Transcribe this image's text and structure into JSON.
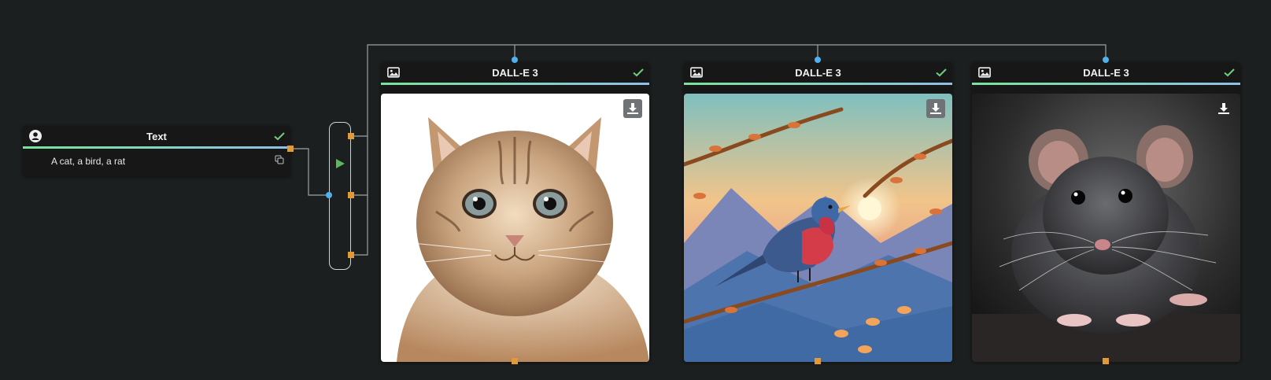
{
  "text_node": {
    "title": "Text",
    "content": "A cat, a bird, a rat"
  },
  "image_nodes": [
    {
      "title": "DALL-E 3",
      "image": "cat portrait",
      "icon": "image-icon"
    },
    {
      "title": "DALL-E 3",
      "image": "robin on branch at sunset",
      "icon": "image-icon"
    },
    {
      "title": "DALL-E 3",
      "image": "grey rat",
      "icon": "image-icon"
    }
  ],
  "colors": {
    "background": "#1c1f1f",
    "node": "#181718",
    "accent_green": "#79e39a",
    "accent_blue": "#8ebfe6",
    "port_orange": "#e19a35",
    "port_blue": "#4fb1ee",
    "check_green": "#6fcf7a"
  },
  "icons": [
    "user-icon",
    "check-icon",
    "copy-icon",
    "image-icon",
    "download-icon",
    "play-icon"
  ]
}
